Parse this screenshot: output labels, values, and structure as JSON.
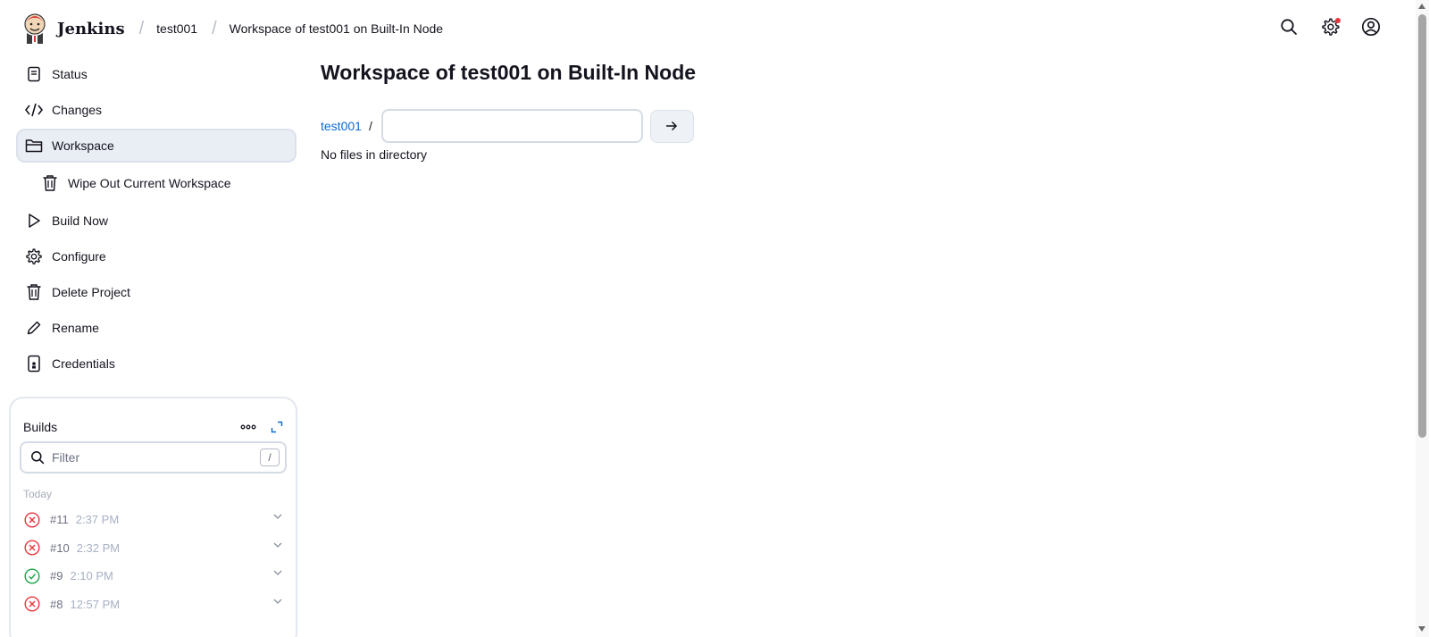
{
  "header": {
    "brand": "Jenkins",
    "breadcrumbs": [
      "test001",
      "Workspace of test001 on Built-In Node"
    ],
    "icons": [
      "search-icon",
      "gear-icon",
      "user-icon"
    ],
    "notification_color": "#e5373f"
  },
  "sidebar": {
    "items": [
      {
        "label": "Status",
        "icon": "document-icon"
      },
      {
        "label": "Changes",
        "icon": "code-icon"
      },
      {
        "label": "Workspace",
        "icon": "folder-icon"
      },
      {
        "label": "Wipe Out Current Workspace",
        "icon": "trash-icon"
      },
      {
        "label": "Build Now",
        "icon": "play-icon"
      },
      {
        "label": "Configure",
        "icon": "gear-icon"
      },
      {
        "label": "Delete Project",
        "icon": "trash-icon"
      },
      {
        "label": "Rename",
        "icon": "pencil-icon"
      },
      {
        "label": "Credentials",
        "icon": "credentials-icon"
      }
    ],
    "active": "Workspace"
  },
  "builds": {
    "title": "Builds",
    "filter_placeholder": "Filter",
    "shortcut": "/",
    "group": "Today",
    "rows": [
      {
        "number": "#11",
        "time": "2:37 PM",
        "status": "failed"
      },
      {
        "number": "#10",
        "time": "2:32 PM",
        "status": "failed"
      },
      {
        "number": "#9",
        "time": "2:10 PM",
        "status": "success"
      },
      {
        "number": "#8",
        "time": "12:57 PM",
        "status": "failed"
      }
    ],
    "colors": {
      "failed": "#e5373f",
      "success": "#1ea446"
    }
  },
  "main": {
    "title": "Workspace of test001 on Built-In Node",
    "path_link": "test001",
    "path_separator": "/",
    "path_input_value": "",
    "empty_message": "No files in directory",
    "link_color": "#0b6bd2"
  }
}
